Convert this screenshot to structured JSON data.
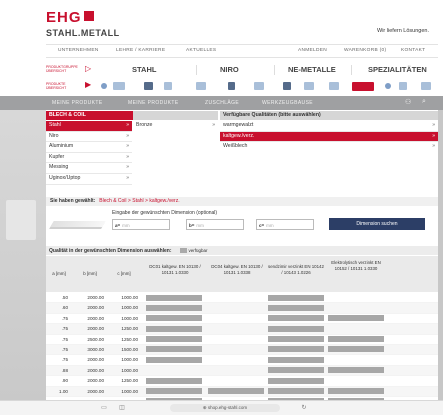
{
  "header": {
    "logo_mark": "EHG",
    "logo_sub": "STAHL.METALL",
    "slogan": "Wir liefern Lösungen."
  },
  "topnav": {
    "items": [
      "UNTERNEHMEN",
      "LEHRE / KARRIERE",
      "AKTUELLES",
      "ANMELDEN",
      "WARENKORB (0)",
      "KONTAKT"
    ]
  },
  "categories": {
    "row1_small": "PRODUKTGRUPPE ÜBERSICHT",
    "row2_small": "PRODUKTE ÜBERSICHT",
    "items": [
      "STAHL",
      "NIRO",
      "NE-METALLE",
      "SPEZIALITÄTEN"
    ]
  },
  "band": {
    "items": [
      "MEINE PRODUKTE",
      "MEINE PRODUKTE",
      "ZUSCHLÄGE",
      "WERKZEUGBAUSE"
    ]
  },
  "panels": {
    "left_title": "BLECH & COIL",
    "left_items": [
      "Stahl",
      "Niro",
      "Aluminium",
      "Kupfer",
      "Messing",
      "Uginox/Uptop"
    ],
    "mid_items": [
      "Bronze"
    ],
    "right_title": "Verfügbare Qualitäten (bitte auswählen)",
    "right_items": [
      "warmgewalzt",
      "kaltgew./verz.",
      "Weißblech"
    ]
  },
  "selection": {
    "label": "Sie haben gewählt:",
    "value": "Blech & Coil > Stahl > kaltgew./verz."
  },
  "dimension": {
    "info": "Eingabe der gewünschten Dimension (optional)",
    "fields": [
      {
        "prefix": "a=",
        "placeholder": "mm"
      },
      {
        "prefix": "b=",
        "placeholder": "mm"
      },
      {
        "prefix": "c=",
        "placeholder": "mm"
      }
    ],
    "button": "Dimension suchen"
  },
  "quality": {
    "title": "Qualität in der gewünschten Dimension auswählen:",
    "legend": "verfügbar",
    "columns": [
      "a [mm]",
      "b [mm]",
      "c [mm]",
      "DC01 kaltgew. EN 10130 / 10131 1.0330",
      "DC04 kaltgew. EN 10130 / 10131 1.0338",
      "sendzimir verzinkt EN 10142 / 10143 1.0226",
      "Elektrolytisch verzinkt EN 10152 / 10131 1.0330"
    ],
    "rows": [
      {
        "a": ".50",
        "b": "2000.00",
        "c": "1000.00",
        "avail": [
          1,
          0,
          1,
          0
        ]
      },
      {
        "a": ".60",
        "b": "2000.00",
        "c": "1000.00",
        "avail": [
          1,
          0,
          1,
          0
        ]
      },
      {
        "a": ".75",
        "b": "2000.00",
        "c": "1000.00",
        "avail": [
          1,
          0,
          1,
          1
        ]
      },
      {
        "a": ".75",
        "b": "2000.00",
        "c": "1250.00",
        "avail": [
          1,
          0,
          1,
          0
        ]
      },
      {
        "a": ".75",
        "b": "2500.00",
        "c": "1250.00",
        "avail": [
          1,
          0,
          1,
          1
        ]
      },
      {
        "a": ".75",
        "b": "3000.00",
        "c": "1500.00",
        "avail": [
          1,
          0,
          1,
          1
        ]
      },
      {
        "a": ".75",
        "b": "2000.00",
        "c": "1000.00",
        "avail": [
          1,
          0,
          1,
          0
        ]
      },
      {
        "a": ".88",
        "b": "2000.00",
        "c": "1000.00",
        "avail": [
          0,
          0,
          1,
          1
        ]
      },
      {
        "a": ".90",
        "b": "2000.00",
        "c": "1250.00",
        "avail": [
          1,
          0,
          1,
          0
        ]
      },
      {
        "a": "1.00",
        "b": "2000.00",
        "c": "1000.00",
        "avail": [
          1,
          1,
          1,
          1
        ]
      },
      {
        "a": "1.00",
        "b": "2000.00",
        "c": "1250.00",
        "avail": [
          1,
          0,
          1,
          1
        ]
      }
    ]
  },
  "browser": {
    "url": "⊕ shop.ehg-stahl.com"
  },
  "colors": {
    "accent": "#c8102e",
    "button": "#2c3e66",
    "band": "#9fa0a2",
    "available": "#a7a7a7"
  }
}
